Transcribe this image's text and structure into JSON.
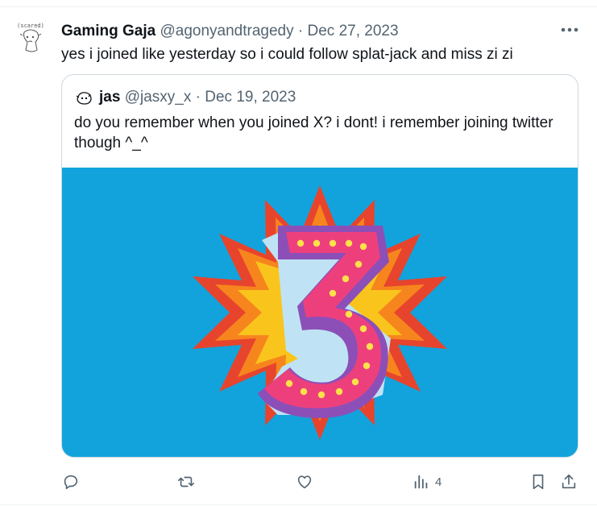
{
  "tweet": {
    "author_name": "Gaming Gaja",
    "handle": "@agonyandtragedy",
    "separator": "·",
    "date": "Dec 27, 2023",
    "text": "yes i joined like yesterday so i could follow splat-jack and miss zi zi",
    "avatar_caption": "(scared)"
  },
  "quoted": {
    "author_name": "jas",
    "handle": "@jasxy_x",
    "separator": "·",
    "date": "Dec 19, 2023",
    "text": "do you remember when you joined X? i dont! i remember joining twitter though ^_^",
    "image_number": "3"
  },
  "actions": {
    "reply_icon": "reply-icon",
    "retweet_icon": "retweet-icon",
    "like_icon": "heart-icon",
    "views_icon": "views-icon",
    "views_count": "4",
    "bookmark_icon": "bookmark-icon",
    "share_icon": "share-icon"
  },
  "colors": {
    "text_primary": "#0f1419",
    "text_secondary": "#536471",
    "border": "#cfd9de",
    "image_bg": "#12a3dc"
  }
}
